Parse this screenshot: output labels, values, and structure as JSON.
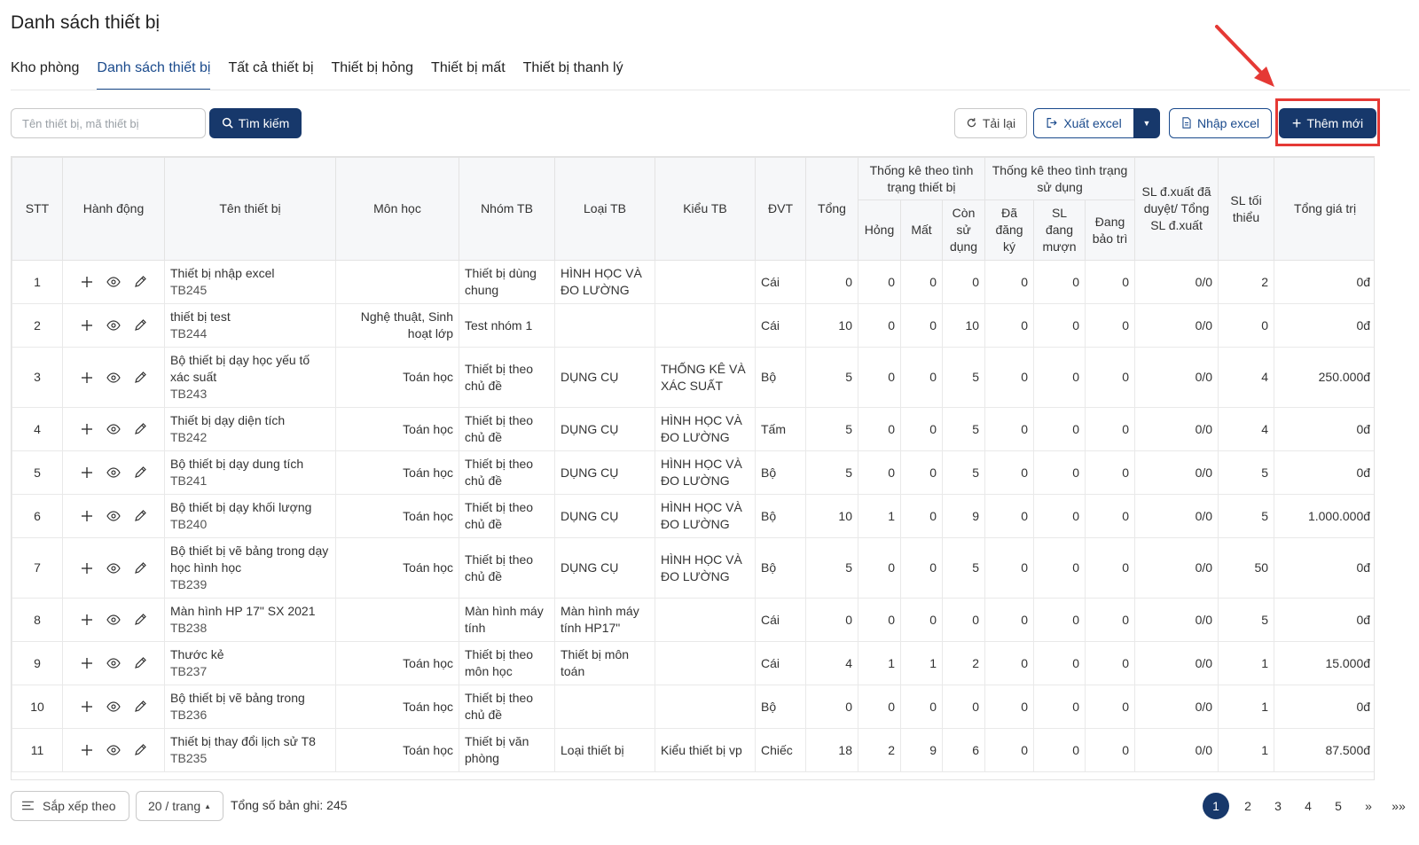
{
  "page": {
    "title": "Danh sách thiết bị"
  },
  "tabs": [
    {
      "label": "Kho phòng"
    },
    {
      "label": "Danh sách thiết bị",
      "active": true
    },
    {
      "label": "Tất cả thiết bị"
    },
    {
      "label": "Thiết bị hỏng"
    },
    {
      "label": "Thiết bị mất"
    },
    {
      "label": "Thiết bị thanh lý"
    }
  ],
  "toolbar": {
    "search_placeholder": "Tên thiết bị, mã thiết bị",
    "search_value": "",
    "search_label": "Tìm kiếm",
    "reload_label": "Tải lại",
    "export_label": "Xuất excel",
    "import_label": "Nhập excel",
    "add_label": "Thêm mới"
  },
  "table": {
    "headers": {
      "stt": "STT",
      "actions": "Hành động",
      "name": "Tên thiết bị",
      "subject": "Môn học",
      "group": "Nhóm TB",
      "type": "Loại TB",
      "kind": "Kiểu TB",
      "unit": "ĐVT",
      "total": "Tổng",
      "status_group": "Thống kê theo tình trạng thiết bị",
      "broken": "Hỏng",
      "lost": "Mất",
      "usable": "Còn sử dụng",
      "usage_group": "Thống kê theo tình trạng sử dụng",
      "registered": "Đã đăng ký",
      "borrowed": "SL đang mượn",
      "maintenance": "Đang bảo trì",
      "proposed": "SL đ.xuất đã duyệt/ Tổng SL đ.xuất",
      "min": "SL tối thiểu",
      "value": "Tổng giá trị"
    },
    "rows": [
      {
        "stt": "1",
        "name": "Thiết bị nhập excel",
        "code": "TB245",
        "subject": "",
        "group": "Thiết bị dùng chung",
        "type": "HÌNH HỌC VÀ ĐO LƯỜNG",
        "kind": "",
        "unit": "Cái",
        "total": "0",
        "broken": "0",
        "lost": "0",
        "usable": "0",
        "registered": "0",
        "borrowed": "0",
        "maintenance": "0",
        "proposed": "0/0",
        "min": "2",
        "value": "0đ"
      },
      {
        "stt": "2",
        "name": "thiết bị test",
        "code": "TB244",
        "subject": "Nghệ thuật, Sinh hoạt lớp",
        "group": "Test nhóm 1",
        "type": "",
        "kind": "",
        "unit": "Cái",
        "total": "10",
        "broken": "0",
        "lost": "0",
        "usable": "10",
        "registered": "0",
        "borrowed": "0",
        "maintenance": "0",
        "proposed": "0/0",
        "min": "0",
        "value": "0đ"
      },
      {
        "stt": "3",
        "name": "Bộ thiết bị dạy học yếu tố xác suất",
        "code": "TB243",
        "subject": "Toán học",
        "group": "Thiết bị theo chủ đề",
        "type": "DỤNG CỤ",
        "kind": "THỐNG KÊ VÀ XÁC SUẤT",
        "unit": "Bộ",
        "total": "5",
        "broken": "0",
        "lost": "0",
        "usable": "5",
        "registered": "0",
        "borrowed": "0",
        "maintenance": "0",
        "proposed": "0/0",
        "min": "4",
        "value": "250.000đ"
      },
      {
        "stt": "4",
        "name": "Thiết bị dạy diện tích",
        "code": "TB242",
        "subject": "Toán học",
        "group": "Thiết bị theo chủ đề",
        "type": "DỤNG CỤ",
        "kind": "HÌNH HỌC VÀ ĐO LƯỜNG",
        "unit": "Tấm",
        "total": "5",
        "broken": "0",
        "lost": "0",
        "usable": "5",
        "registered": "0",
        "borrowed": "0",
        "maintenance": "0",
        "proposed": "0/0",
        "min": "4",
        "value": "0đ"
      },
      {
        "stt": "5",
        "name": "Bộ thiết bị dạy dung tích",
        "code": "TB241",
        "subject": "Toán học",
        "group": "Thiết bị theo chủ đề",
        "type": "DỤNG CỤ",
        "kind": "HÌNH HỌC VÀ ĐO LƯỜNG",
        "unit": "Bộ",
        "total": "5",
        "broken": "0",
        "lost": "0",
        "usable": "5",
        "registered": "0",
        "borrowed": "0",
        "maintenance": "0",
        "proposed": "0/0",
        "min": "5",
        "value": "0đ"
      },
      {
        "stt": "6",
        "name": "Bộ thiết bị dạy khối lượng",
        "code": "TB240",
        "subject": "Toán học",
        "group": "Thiết bị theo chủ đề",
        "type": "DỤNG CỤ",
        "kind": "HÌNH HỌC VÀ ĐO LƯỜNG",
        "unit": "Bộ",
        "total": "10",
        "broken": "1",
        "lost": "0",
        "usable": "9",
        "registered": "0",
        "borrowed": "0",
        "maintenance": "0",
        "proposed": "0/0",
        "min": "5",
        "value": "1.000.000đ"
      },
      {
        "stt": "7",
        "name": "Bộ thiết bị vẽ bảng trong dạy học hình học",
        "code": "TB239",
        "subject": "Toán học",
        "group": "Thiết bị theo chủ đề",
        "type": "DỤNG CỤ",
        "kind": "HÌNH HỌC VÀ ĐO LƯỜNG",
        "unit": "Bộ",
        "total": "5",
        "broken": "0",
        "lost": "0",
        "usable": "5",
        "registered": "0",
        "borrowed": "0",
        "maintenance": "0",
        "proposed": "0/0",
        "min": "50",
        "value": "0đ"
      },
      {
        "stt": "8",
        "name": "Màn hình HP 17\" SX 2021",
        "code": "TB238",
        "subject": "",
        "group": "Màn hình máy tính",
        "type": "Màn hình máy tính HP17\"",
        "kind": "",
        "unit": "Cái",
        "total": "0",
        "broken": "0",
        "lost": "0",
        "usable": "0",
        "registered": "0",
        "borrowed": "0",
        "maintenance": "0",
        "proposed": "0/0",
        "min": "5",
        "value": "0đ"
      },
      {
        "stt": "9",
        "name": "Thước kẻ",
        "code": "TB237",
        "subject": "Toán học",
        "group": "Thiết bị theo môn học",
        "type": "Thiết bị môn toán",
        "kind": "",
        "unit": "Cái",
        "total": "4",
        "broken": "1",
        "lost": "1",
        "usable": "2",
        "registered": "0",
        "borrowed": "0",
        "maintenance": "0",
        "proposed": "0/0",
        "min": "1",
        "value": "15.000đ"
      },
      {
        "stt": "10",
        "name": "Bộ thiết bị vẽ bảng trong",
        "code": "TB236",
        "subject": "Toán học",
        "group": "Thiết bị theo chủ đề",
        "type": "",
        "kind": "",
        "unit": "Bộ",
        "total": "0",
        "broken": "0",
        "lost": "0",
        "usable": "0",
        "registered": "0",
        "borrowed": "0",
        "maintenance": "0",
        "proposed": "0/0",
        "min": "1",
        "value": "0đ"
      },
      {
        "stt": "11",
        "name": "Thiết bị thay đổi lịch sử T8",
        "code": "TB235",
        "subject": "Toán học",
        "group": "Thiết bị văn phòng",
        "type": "Loại thiết bị",
        "kind": "Kiểu thiết bị vp",
        "unit": "Chiếc",
        "total": "18",
        "broken": "2",
        "lost": "9",
        "usable": "6",
        "registered": "0",
        "borrowed": "0",
        "maintenance": "0",
        "proposed": "0/0",
        "min": "1",
        "value": "87.500đ"
      }
    ]
  },
  "footer": {
    "sort_label": "Sắp xếp theo",
    "page_size": "20 / trang",
    "total_text": "Tổng số bản ghi: 245",
    "pages": [
      "1",
      "2",
      "3",
      "4",
      "5"
    ],
    "next": "»",
    "last": "»»"
  },
  "colors": {
    "primary": "#17386b",
    "highlight": "#e53935"
  }
}
